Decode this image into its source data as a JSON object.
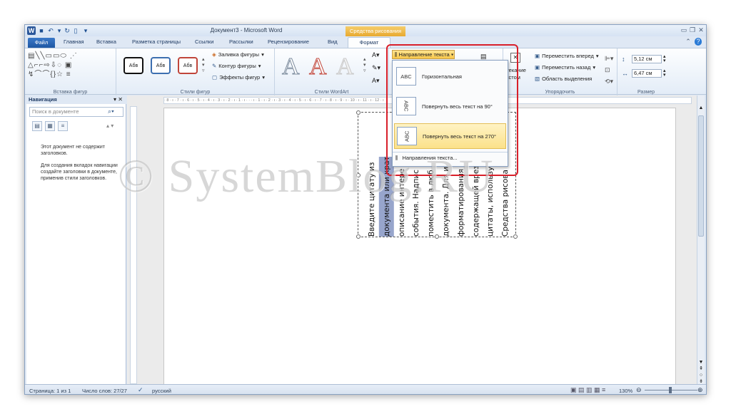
{
  "window": {
    "title": "Документ3 - Microsoft Word",
    "context_title": "Средства рисования",
    "qat_icons": [
      "word-icon",
      "save-icon",
      "undo-icon",
      "redo-icon",
      "new-doc-icon",
      "customize-icon"
    ]
  },
  "tabs": [
    "Файл",
    "Главная",
    "Вставка",
    "Разметка страницы",
    "Ссылки",
    "Рассылки",
    "Рецензирование",
    "Вид",
    "Формат"
  ],
  "ribbon": {
    "groups": {
      "insert_shapes": "Вставка фигур",
      "shape_styles": "Стили фигур",
      "wordart_styles": "Стили WordArt",
      "arrange": "Упорядочить",
      "size": "Размер"
    },
    "style_sample": "Абв",
    "shape_fill": "Заливка фигуры",
    "shape_outline": "Контур фигуры",
    "shape_effects": "Эффекты фигур",
    "wordart_letter": "A",
    "wrap_text_1": "бтекание",
    "wrap_text_2": "екстом",
    "bring_forward": "Переместить вперед",
    "send_backward": "Переместить назад",
    "selection_pane": "Область выделения",
    "height_value": "5,12 см",
    "width_value": "6,47 см"
  },
  "text_direction": {
    "button_label": "Направление текста",
    "items": [
      {
        "icon_text": "ABC",
        "label": "Горизонтальная"
      },
      {
        "icon_text": "ABC",
        "label": "Повернуть весь текст на 90°"
      },
      {
        "icon_text": "ABC",
        "label": "Повернуть весь текст на 270°"
      }
    ],
    "footer": "Направления текста..."
  },
  "nav": {
    "title": "Навигация",
    "search_placeholder": "Поиск в документе",
    "message_1": "Этот документ не содержит заголовков.",
    "message_2": "Для создания вкладок навигации создайте заголовки в документе, применив стили заголовков."
  },
  "textbox": {
    "columns": [
      "Введите цитату из",
      "документа или краткое",
      "описание интере",
      "события. Надпис",
      "поместить в люб",
      "документа. Для и",
      "форматирования",
      "содержащей врез",
      "цитаты, использу",
      "Средства рисова"
    ]
  },
  "ruler": {
    "marks": "· 8 · ı · 7 · ı · 6 · ı · 5 · ı · 4 · ı · 3 · ı · 2 · ı · 1 · ı · · · ı · 1 · ı · 2 · ı · 3 · ı · 4 · ı · 5 · ı · 6 · ı · 7 · ı · 8 · ı · 9 · ı · 10 · ı · 11 · ı · 12 · ı"
  },
  "status": {
    "page": "Страница: 1 из 1",
    "words": "Число слов: 27/27",
    "language": "русский",
    "zoom": "130%"
  },
  "watermark": "© SystemBlog.RU",
  "colors": {
    "accent": "#2b579a",
    "context_tab": "#f0b43c",
    "highlight": "#97a5cc",
    "annotation_box": "#d81f2a"
  }
}
